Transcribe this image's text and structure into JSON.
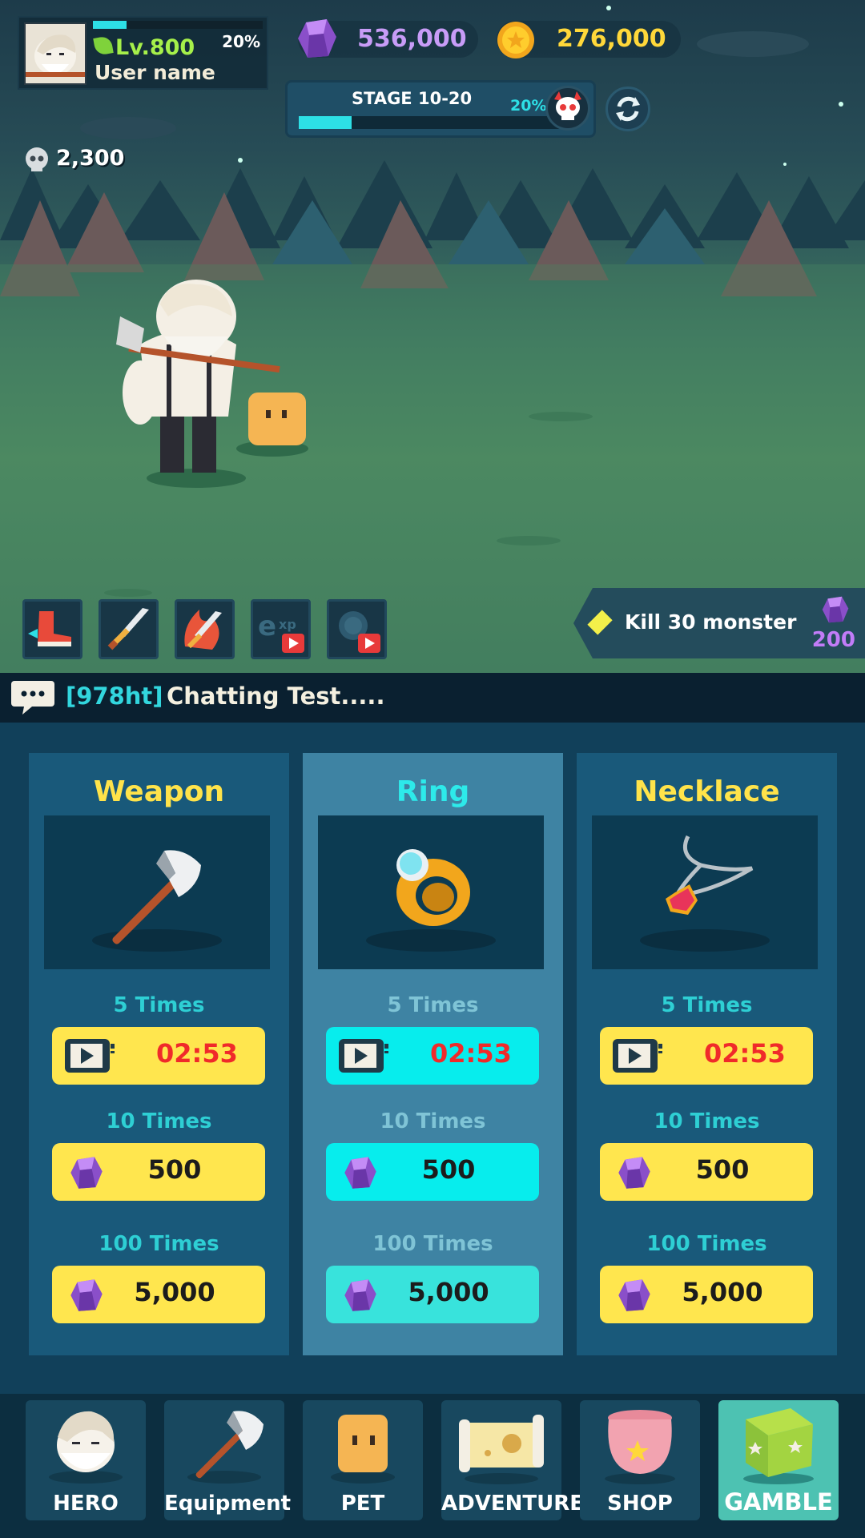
{
  "hud": {
    "level": "Lv.800",
    "username": "User name",
    "exp_percent_label": "20%",
    "exp_progress": 0.2,
    "gems": "536,000",
    "gold": "276,000",
    "stage_label": "STAGE 10-20",
    "stage_percent_label": "20%",
    "stage_progress": 0.2,
    "kill_count": "2,300"
  },
  "skills": [
    {
      "icon": "boot-icon"
    },
    {
      "icon": "sword-icon"
    },
    {
      "icon": "fire-sword-icon"
    },
    {
      "icon": "exp-boost-icon"
    },
    {
      "icon": "gold-boost-icon"
    }
  ],
  "quest": {
    "text": "Kill 30 monster",
    "reward": "200"
  },
  "chat": {
    "user": "[978ht]",
    "message": "Chatting Test....."
  },
  "gamble": {
    "cards": [
      {
        "title": "Weapon",
        "row1_label": "5 Times",
        "timer": "02:53",
        "row2_label": "10 Times",
        "cost_10": "500",
        "row3_label": "100 Times",
        "cost_100": "5,000"
      },
      {
        "title": "Ring",
        "row1_label": "5 Times",
        "timer": "02:53",
        "row2_label": "10 Times",
        "cost_10": "500",
        "row3_label": "100 Times",
        "cost_100": "5,000"
      },
      {
        "title": "Necklace",
        "row1_label": "5 Times",
        "timer": "02:53",
        "row2_label": "10 Times",
        "cost_10": "500",
        "row3_label": "100 Times",
        "cost_100": "5,000"
      }
    ]
  },
  "nav": {
    "items": [
      {
        "label": "HERO"
      },
      {
        "label": "Equipment"
      },
      {
        "label": "PET"
      },
      {
        "label": "ADVENTURE"
      },
      {
        "label": "SHOP"
      },
      {
        "label": "GAMBLE"
      }
    ]
  },
  "colors": {
    "accent_cyan": "#2de0e6",
    "button_yellow": "#ffe64e",
    "gem_purple": "#c89cf7",
    "gold_yellow": "#ffd83a",
    "timer_red": "#f02a2a"
  }
}
